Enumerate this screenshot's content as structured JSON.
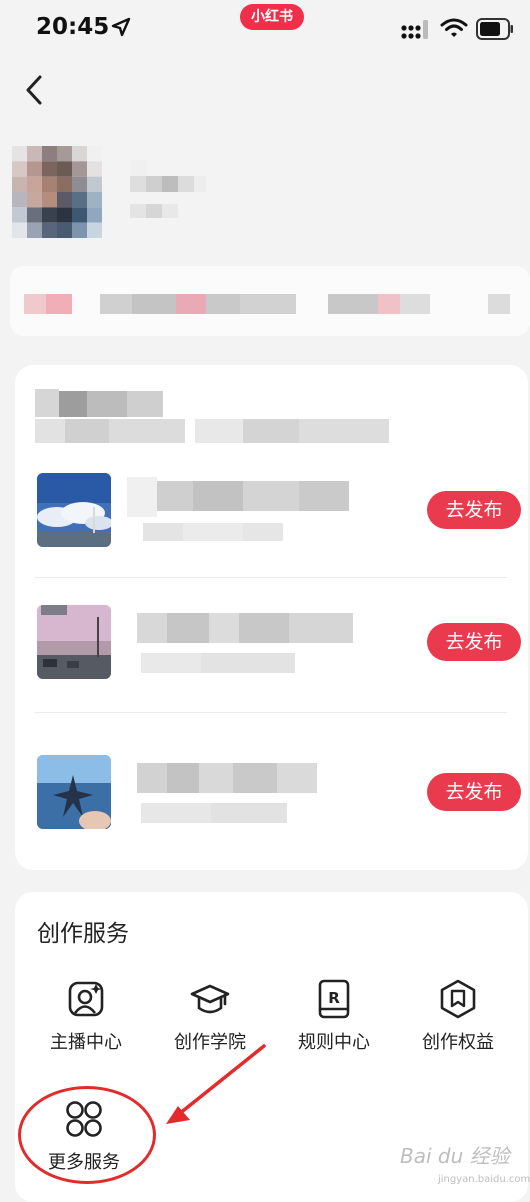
{
  "status_bar": {
    "time": "20:45",
    "app_badge": "小红书"
  },
  "navigation": {
    "back_icon": "chevron-left-icon"
  },
  "recommended_topics": {
    "items": [
      {
        "thumb": "sky-clouds-photo",
        "button_label": "去发布"
      },
      {
        "thumb": "sunset-street-photo",
        "button_label": "去发布"
      },
      {
        "thumb": "starfish-sea-photo",
        "button_label": "去发布"
      }
    ]
  },
  "creation_services": {
    "title": "创作服务",
    "items": [
      {
        "label": "主播中心",
        "icon": "anchor-center-icon"
      },
      {
        "label": "创作学院",
        "icon": "graduation-cap-icon"
      },
      {
        "label": "规则中心",
        "icon": "rules-book-icon"
      },
      {
        "label": "创作权益",
        "icon": "bookmark-shield-icon"
      },
      {
        "label": "更多服务",
        "icon": "four-circles-icon"
      }
    ]
  },
  "colors": {
    "accent": "#ea3a4d",
    "brand": "#f0304a",
    "annotation": "#e32b2b"
  },
  "watermark": {
    "text": "Bai du 经验",
    "sub": "jingyan.baidu.com"
  }
}
